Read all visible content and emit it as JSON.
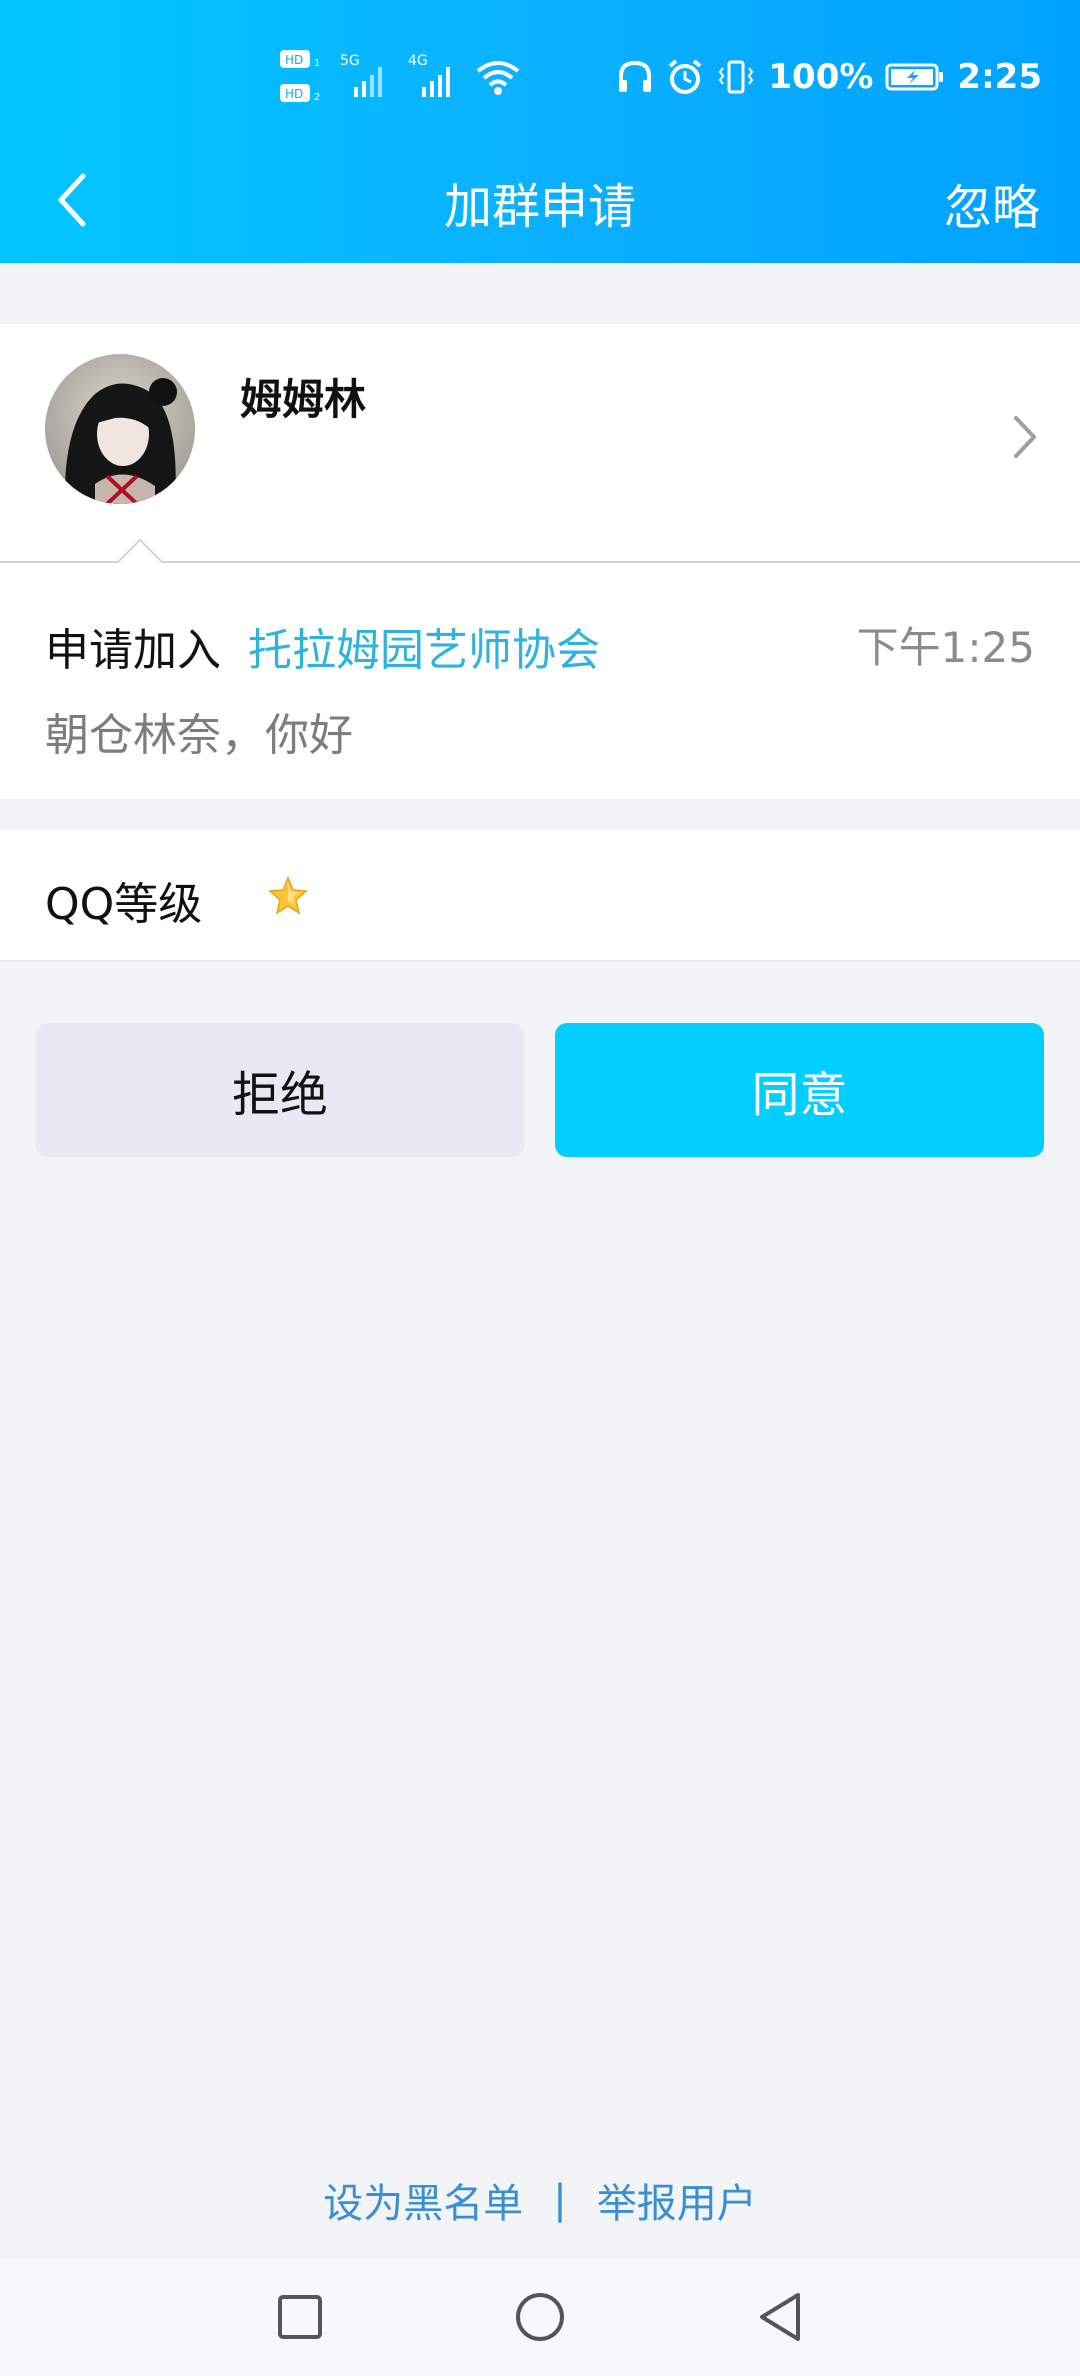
{
  "status_bar": {
    "time": "2:25",
    "battery": "100%",
    "sim1": "HD1",
    "sim2": "HD2",
    "network1": "5G",
    "network2": "4G"
  },
  "header": {
    "title": "加群申请",
    "ignore_label": "忽略"
  },
  "user": {
    "name": "姆姆林"
  },
  "request": {
    "prefix": "申请加入",
    "group_name": "托拉姆园艺师协会",
    "time": "下午1:25",
    "message": "朝仓林奈，你好"
  },
  "level": {
    "label": "QQ等级"
  },
  "actions": {
    "reject_label": "拒绝",
    "accept_label": "同意"
  },
  "footer": {
    "blacklist_label": "设为黑名单",
    "separator": "|",
    "report_label": "举报用户"
  },
  "colors": {
    "accent": "#00cfff",
    "link": "#2fb3dd",
    "background": "#f2f4f8"
  }
}
